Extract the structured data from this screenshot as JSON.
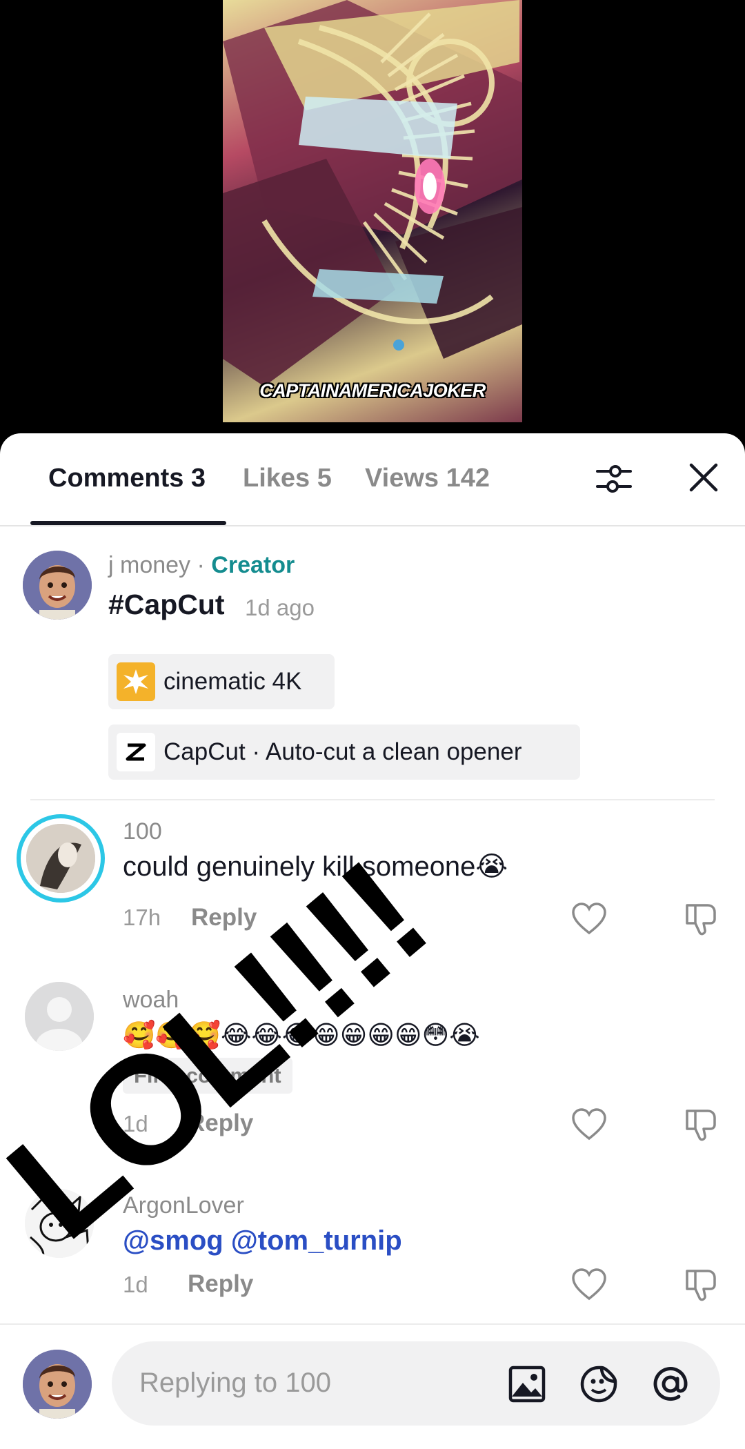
{
  "video": {
    "caption": "CAPTAINAMERICAJOKER"
  },
  "tabs": {
    "comments": "Comments 3",
    "likes": "Likes 5",
    "views": "Views 142"
  },
  "caption_post": {
    "username": "j money",
    "separator": " · ",
    "badge": "Creator",
    "text": "#CapCut",
    "time": "1d ago",
    "chips": [
      {
        "label": "cinematic 4K",
        "icon": "sparkle-effect-icon"
      },
      {
        "label": "CapCut · Auto-cut a clean opener",
        "icon": "capcut-logo-icon"
      }
    ]
  },
  "comments": [
    {
      "username": "100",
      "text": "could genuinely kill someone😭",
      "time": "17h",
      "reply": "Reply"
    },
    {
      "username": "woah",
      "text": "🥰🥰🥰😂😂😂😁😁😁😁😳😭",
      "badge": "First comment",
      "time": "1d",
      "reply": "Reply"
    },
    {
      "username": "ArgonLover",
      "text": "@smog @tom_turnip",
      "time": "1d",
      "reply": "Reply"
    }
  ],
  "overlay": {
    "text": "LOL!!!!"
  },
  "input": {
    "placeholder": "Replying to 100"
  },
  "colors": {
    "creator": "#148c8f",
    "mention": "#2a4ec4",
    "story_ring": "#2cc7e6"
  }
}
